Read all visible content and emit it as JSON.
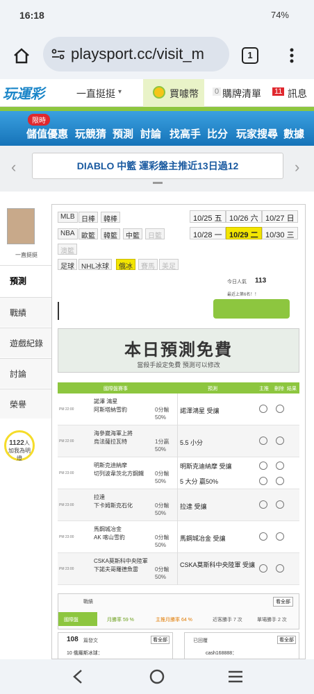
{
  "status": {
    "time": "16:18",
    "battery": "74%"
  },
  "browser": {
    "url": "playsport.cc/visit_m",
    "tab_count": "1"
  },
  "nav": {
    "logo": "玩運彩",
    "user": "一直挺挺",
    "buy": "買噱幣",
    "cart_count": "0",
    "cart": "購牌清單",
    "msg_count": "11",
    "msg": "訊息"
  },
  "menu": {
    "badge": "限時",
    "items": [
      "儲值優惠",
      "玩競猜",
      "預測",
      "討論",
      "找高手",
      "比分",
      "玩家搜尋",
      "數據"
    ]
  },
  "marquee": {
    "text": "DIABLO 中籃 運彩盤主推近13日過12"
  },
  "sidebar": {
    "name": "一直挺挺",
    "items": [
      "預測",
      "戰績",
      "遊戲紀錄",
      "討論",
      "榮譽"
    ],
    "fans_count": "1122",
    "fans_unit": "人",
    "fans_label": "加我為明燈"
  },
  "leagues": [
    "MLB",
    "日棒",
    "韓棒",
    "NBA",
    "歐籃",
    "韓籃",
    "中籃",
    "日籃",
    "澳籃",
    "足球",
    "NHL冰球",
    "俄冰",
    "賽馬",
    "美足"
  ],
  "dates": [
    "10/25 五",
    "10/26 六",
    "10/27 日",
    "10/28 一",
    "10/29 二",
    "10/30 三"
  ],
  "popularity": {
    "label": "今日人氣",
    "value": "113",
    "rank": "最近上第6名！！"
  },
  "free": {
    "title": "本日預測免費",
    "subtitle": "當殺手設定免費 預測可以修改"
  },
  "table": {
    "head": [
      "國際盤賽事",
      "預測",
      "主推",
      "刪除",
      "結果"
    ],
    "rows": [
      {
        "time": "PM 22:00",
        "home": "諾澤 鴻星",
        "away": "阿斯塔納雪豹",
        "odd": "0分輸",
        "pct": "50%",
        "pick": "諾澤鴻星 受讓"
      },
      {
        "time": "PM 22:00",
        "home": "海參崴海軍上將",
        "away": "烏法薩拉瓦特",
        "odd": "1分贏",
        "pct": "50%",
        "pick": "5.5 小分"
      },
      {
        "time": "PM 23:00",
        "home": "明斯克迪納摩",
        "away": "切列波韋茨北方鋼鐵",
        "odd": "0分輸",
        "pct": "50%",
        "pick": "明斯克迪納摩 受讓",
        "pick2": "5 大分 贏50%"
      },
      {
        "time": "PM 23:00",
        "home": "拉達",
        "away": "下卡姆斯克石化",
        "odd": "0分輸",
        "pct": "50%",
        "pick": "拉達 受讓"
      },
      {
        "time": "PM 23:00",
        "home": "馬鋼城冶金",
        "away": "AK 喀山雪豹",
        "odd": "0分輸",
        "pct": "50%",
        "pick": "馬鋼城冶金 受讓"
      },
      {
        "time": "PM 23:00",
        "home": "CSKA莫斯科中央陸軍",
        "away": "下諾夫哥羅德魚雷",
        "odd": "0分輸",
        "pct": "50%",
        "pick": "CSKA莫斯科中央陸軍 受讓"
      }
    ]
  },
  "stats": {
    "label": "戰績",
    "more": "看全部",
    "items": [
      "國際盤",
      "月勝率 59 %",
      "主推月勝率 64 %",
      "近客勝手 7 次",
      "單場勝手 2 次"
    ]
  },
  "bottom": {
    "left_num": "108",
    "left_label": "篇發文",
    "right_label": "已回覆",
    "more": "看全部",
    "row1": "10  俄羅斯冰球：",
    "row2": "cash168888："
  }
}
